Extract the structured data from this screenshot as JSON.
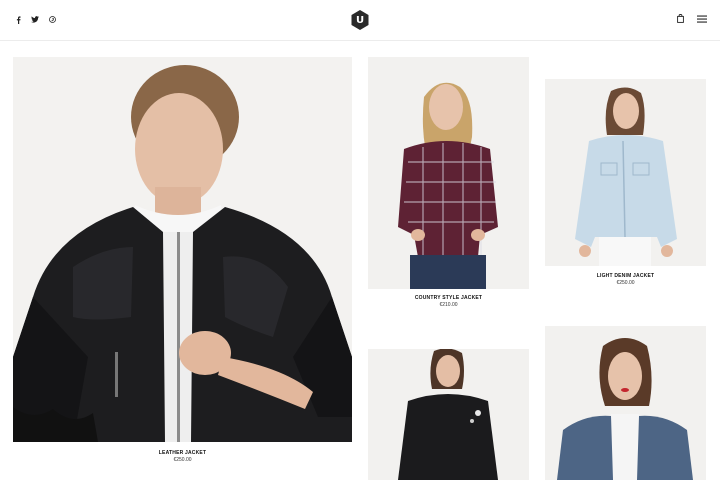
{
  "header": {
    "logo_letter": "U",
    "social_icons": [
      "facebook-icon",
      "twitter-icon",
      "pinterest-icon"
    ],
    "right_icons": [
      "shopping-bag-icon",
      "hamburger-menu-icon"
    ]
  },
  "products": [
    {
      "name": "LEATHER JACKET",
      "price": "€250.00"
    },
    {
      "name": "COUNTRY STYLE JACKET",
      "price": "€210.00"
    },
    {
      "name": "LIGHT DENIM JACKET",
      "price": "€250.00"
    },
    {
      "name": "",
      "price": ""
    },
    {
      "name": "",
      "price": ""
    }
  ],
  "colors": {
    "background": "#ffffff",
    "photo_bg": "#f0efed",
    "text": "#111111",
    "logo": "#2a2a2a"
  }
}
